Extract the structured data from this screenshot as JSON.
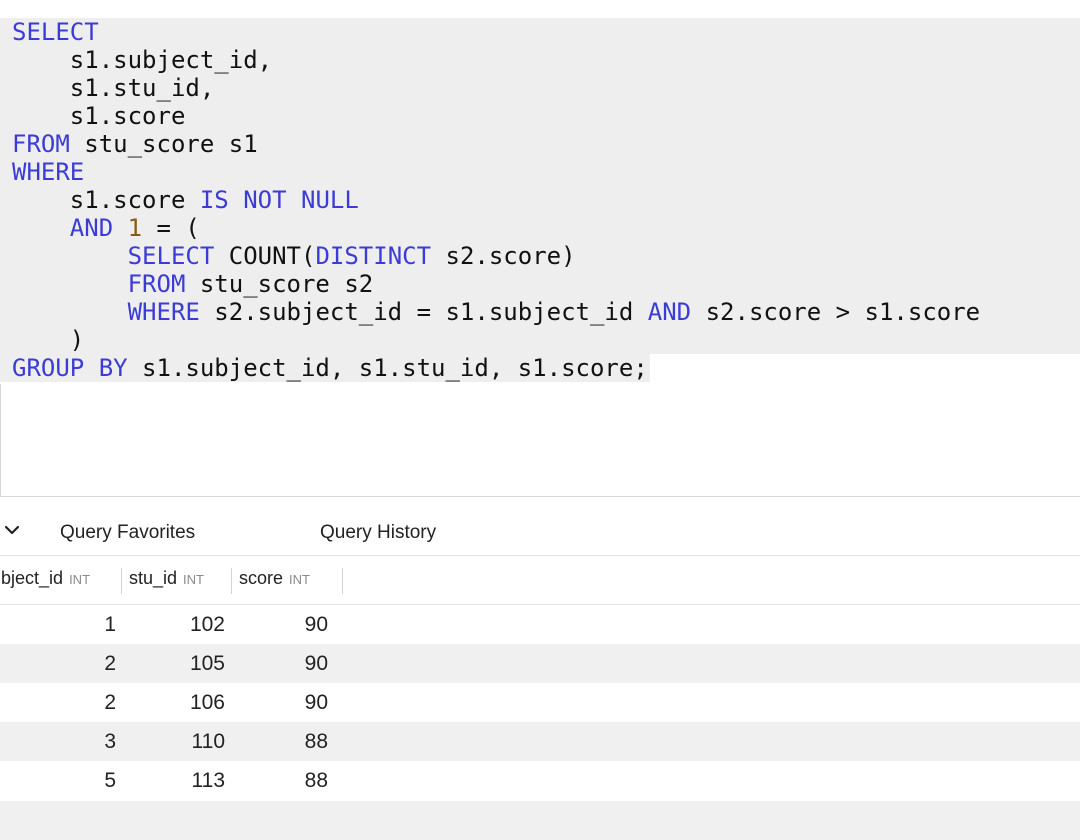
{
  "editor": {
    "lines": [
      [
        {
          "t": "SELECT",
          "c": "kw"
        }
      ],
      [
        {
          "t": "    s1.subject_id,"
        }
      ],
      [
        {
          "t": "    s1.stu_id,"
        }
      ],
      [
        {
          "t": "    s1.score"
        }
      ],
      [
        {
          "t": "FROM",
          "c": "kw"
        },
        {
          "t": " stu_score s1"
        }
      ],
      [
        {
          "t": "WHERE",
          "c": "kw"
        }
      ],
      [
        {
          "t": "    s1.score "
        },
        {
          "t": "IS NOT NULL",
          "c": "kw"
        }
      ],
      [
        {
          "t": "    "
        },
        {
          "t": "AND",
          "c": "kw"
        },
        {
          "t": " "
        },
        {
          "t": "1",
          "c": "num"
        },
        {
          "t": " = ("
        }
      ],
      [
        {
          "t": "        "
        },
        {
          "t": "SELECT",
          "c": "kw"
        },
        {
          "t": " COUNT("
        },
        {
          "t": "DISTINCT",
          "c": "kw"
        },
        {
          "t": " s2.score)"
        }
      ],
      [
        {
          "t": "        "
        },
        {
          "t": "FROM",
          "c": "kw"
        },
        {
          "t": " stu_score s2"
        }
      ],
      [
        {
          "t": "        "
        },
        {
          "t": "WHERE",
          "c": "kw"
        },
        {
          "t": " s2.subject_id = s1.subject_id "
        },
        {
          "t": "AND",
          "c": "kw"
        },
        {
          "t": " s2.score > s1.score"
        }
      ],
      [
        {
          "t": "    )"
        }
      ],
      [
        {
          "t": "GROUP BY",
          "c": "kw"
        },
        {
          "t": " s1.subject_id, s1.stu_id, s1.score;"
        }
      ]
    ]
  },
  "toolbar": {
    "collapse_icon": "chevron-down-icon",
    "tabs": [
      "Query Favorites",
      "Query History"
    ]
  },
  "results": {
    "columns": [
      {
        "name": "subject_id",
        "type": "INT"
      },
      {
        "name": "stu_id",
        "type": "INT"
      },
      {
        "name": "score",
        "type": "INT"
      }
    ],
    "rows": [
      [
        "1",
        "102",
        "90"
      ],
      [
        "2",
        "105",
        "90"
      ],
      [
        "2",
        "106",
        "90"
      ],
      [
        "3",
        "110",
        "88"
      ],
      [
        "5",
        "113",
        "88"
      ]
    ]
  },
  "colors": {
    "keyword": "#3b3bd6",
    "number": "#8a5a10",
    "code_bg": "#eeeeee",
    "row_alt_bg": "#f0f0f0"
  }
}
